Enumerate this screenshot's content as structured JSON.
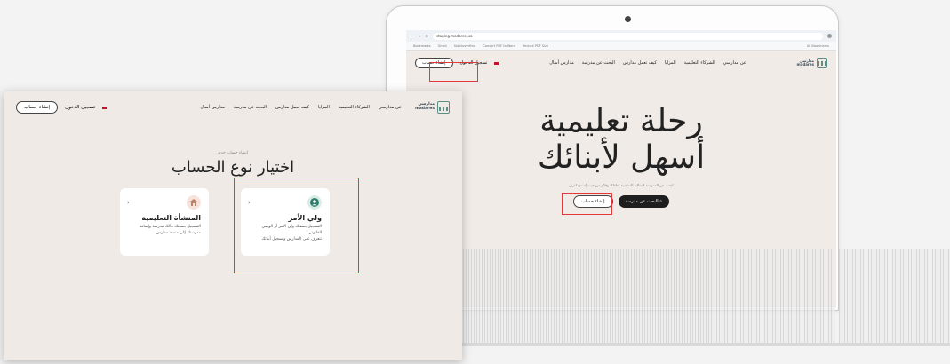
{
  "browser": {
    "url": "staging.madaresi.sa",
    "bookmarks": [
      "Bookmarks",
      "Gmail",
      "Stackoverflow",
      "Convert PDF to Word",
      "Reduce PDF Size",
      "All Bookmarks"
    ]
  },
  "brand": {
    "logo_line1": "مدارسي",
    "logo_line2": "madares"
  },
  "nav": {
    "items": [
      "عن مدارسي",
      "الشركاء التعليمية",
      "المزايا",
      "كيف تعمل مدارس",
      "البحث عن مدرسة",
      "مدارس أسال"
    ],
    "login": "تسجيل الدخول",
    "create_account": "إنشاء حساب"
  },
  "hero": {
    "title_line1": "رحلة تعليمية",
    "title_line2": "أسهل لأبنائك",
    "subtitle": "ابحث عن المدرسة المثالية المناسبة لطفلك وقدّم من حيث يُسمح لفرق",
    "search_button": "البحث عن مدرسة",
    "create_button": "إنشاء حساب"
  },
  "signup": {
    "breadcrumb": "إنشاء حساب جديد",
    "title": "اختيار نوع الحساب",
    "cards": [
      {
        "title": "ولي الأمر",
        "desc_line1": "التسجيل بصفتك ولي الأمر أو الوصي القانوني",
        "desc_line2": "تتعرف على المدارس وتسجيل أبنائك",
        "accent": "#2f7d6c"
      },
      {
        "title": "المنشأة التعليمية",
        "desc_line1": "التسجيل بصفتك مالك مدرسة وإضافة",
        "desc_line2": "مدرستك إلى منصة مدارس",
        "accent": "#c0826b"
      }
    ]
  },
  "colors": {
    "highlight": "#e23a3a",
    "background": "#efeae6"
  }
}
